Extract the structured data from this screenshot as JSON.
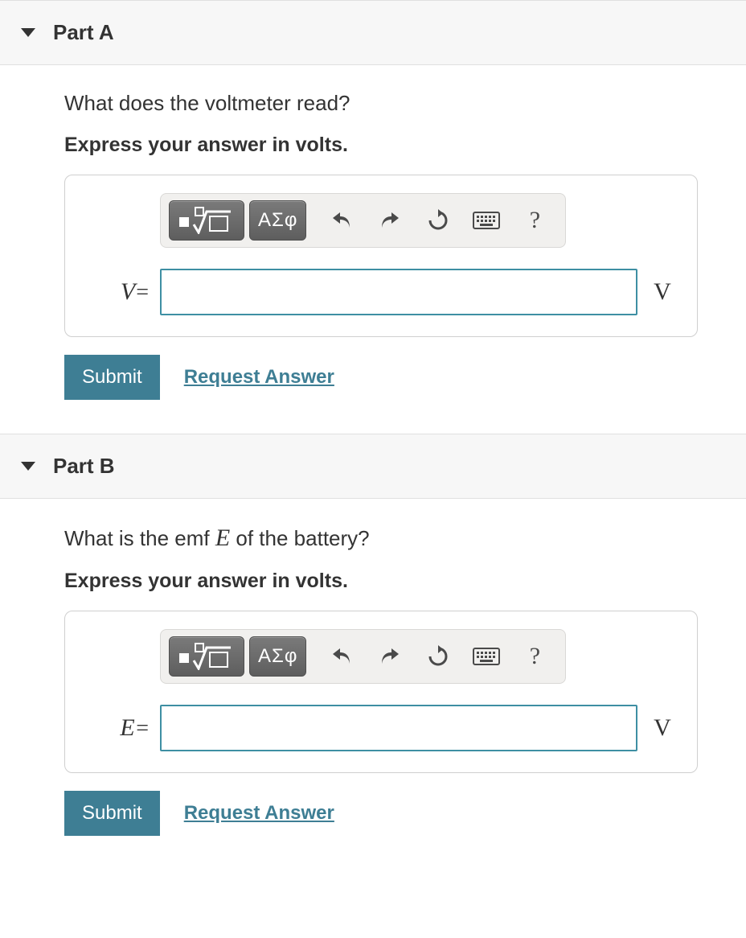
{
  "parts": [
    {
      "title": "Part A",
      "question": "What does the voltmeter read?",
      "instruction": "Express your answer in volts.",
      "toolbar": {
        "math_button": "math-template",
        "greek_button": "ΑΣφ",
        "undo": "↶",
        "redo": "↷",
        "reset": "↻",
        "keyboard": "⌨",
        "help": "?"
      },
      "variable": "V",
      "equals": "=",
      "value": "",
      "unit": "V",
      "submit": "Submit",
      "request_answer": "Request Answer"
    },
    {
      "title": "Part B",
      "question_prefix": "What is the emf ",
      "question_symbol": "E",
      "question_suffix": " of the battery?",
      "instruction": "Express your answer in volts.",
      "toolbar": {
        "math_button": "math-template",
        "greek_button": "ΑΣφ",
        "undo": "↶",
        "redo": "↷",
        "reset": "↻",
        "keyboard": "⌨",
        "help": "?"
      },
      "variable": "E",
      "equals": "=",
      "value": "",
      "unit": "V",
      "submit": "Submit",
      "request_answer": "Request Answer"
    }
  ]
}
